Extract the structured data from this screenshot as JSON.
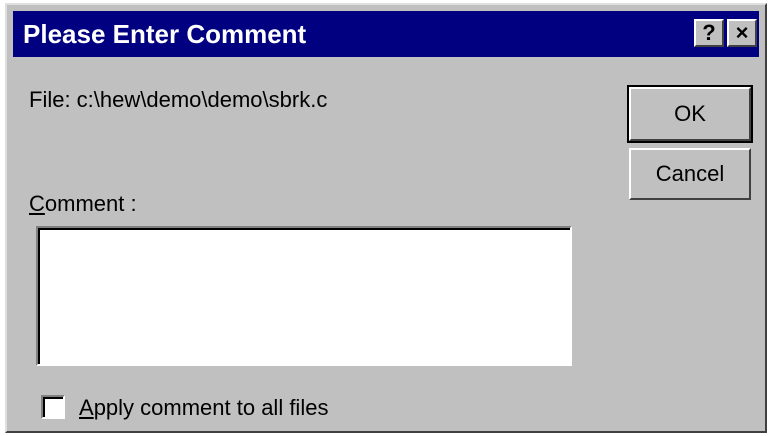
{
  "dialog": {
    "title": "Please Enter Comment",
    "help_button": "?",
    "close_button": "×"
  },
  "file_label": "File: c:\\hew\\demo\\demo\\sbrk.c",
  "comment": {
    "label_first": "C",
    "label_rest": "omment :",
    "value": ""
  },
  "buttons": {
    "ok": "OK",
    "cancel": "Cancel"
  },
  "apply_all": {
    "label_first": "A",
    "label_rest": "pply comment to all files",
    "checked": false
  },
  "colors": {
    "titlebar": "#000080",
    "face": "#c0c0c0"
  }
}
